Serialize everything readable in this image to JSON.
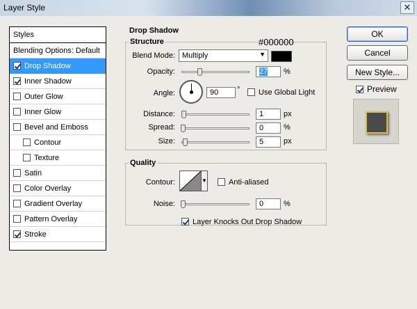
{
  "window": {
    "title": "Layer Style",
    "close_symbol": "✕"
  },
  "styles_panel": {
    "header": "Styles",
    "items": [
      {
        "label": "Blending Options: Default",
        "checkbox": false,
        "checked": false,
        "selected": false,
        "sub": false
      },
      {
        "label": "Drop Shadow",
        "checkbox": true,
        "checked": true,
        "selected": true,
        "sub": false
      },
      {
        "label": "Inner Shadow",
        "checkbox": true,
        "checked": true,
        "selected": false,
        "sub": false
      },
      {
        "label": "Outer Glow",
        "checkbox": true,
        "checked": false,
        "selected": false,
        "sub": false
      },
      {
        "label": "Inner Glow",
        "checkbox": true,
        "checked": false,
        "selected": false,
        "sub": false
      },
      {
        "label": "Bevel and Emboss",
        "checkbox": true,
        "checked": false,
        "selected": false,
        "sub": false
      },
      {
        "label": "Contour",
        "checkbox": true,
        "checked": false,
        "selected": false,
        "sub": true
      },
      {
        "label": "Texture",
        "checkbox": true,
        "checked": false,
        "selected": false,
        "sub": true
      },
      {
        "label": "Satin",
        "checkbox": true,
        "checked": false,
        "selected": false,
        "sub": false
      },
      {
        "label": "Color Overlay",
        "checkbox": true,
        "checked": false,
        "selected": false,
        "sub": false
      },
      {
        "label": "Gradient Overlay",
        "checkbox": true,
        "checked": false,
        "selected": false,
        "sub": false
      },
      {
        "label": "Pattern Overlay",
        "checkbox": true,
        "checked": false,
        "selected": false,
        "sub": false
      },
      {
        "label": "Stroke",
        "checkbox": true,
        "checked": true,
        "selected": false,
        "sub": false
      }
    ]
  },
  "drop_shadow": {
    "title": "Drop Shadow",
    "structure": {
      "title": "Structure",
      "hex_annotation": "#000000",
      "blend_mode_label": "Blend Mode:",
      "blend_mode_value": "Multiply",
      "shadow_color": "#000000",
      "opacity_label": "Opacity:",
      "opacity_value": "27",
      "opacity_unit": "%",
      "angle_label": "Angle:",
      "angle_value": "90",
      "angle_unit": "°",
      "use_global_light_label": "Use Global Light",
      "distance_label": "Distance:",
      "distance_value": "1",
      "distance_unit": "px",
      "spread_label": "Spread:",
      "spread_value": "0",
      "spread_unit": "%",
      "size_label": "Size:",
      "size_value": "5",
      "size_unit": "px"
    },
    "quality": {
      "title": "Quality",
      "contour_label": "Contour:",
      "anti_aliased_label": "Anti-aliased",
      "noise_label": "Noise:",
      "noise_value": "0",
      "noise_unit": "%"
    },
    "knockout_label": "Layer Knocks Out Drop Shadow"
  },
  "buttons": {
    "ok": "OK",
    "cancel": "Cancel",
    "new_style": "New Style...",
    "preview_label": "Preview"
  },
  "colors": {
    "selection": "#3399ff",
    "dialog_bg": "#ecebe6",
    "preview_stroke": "#d5c14a"
  }
}
